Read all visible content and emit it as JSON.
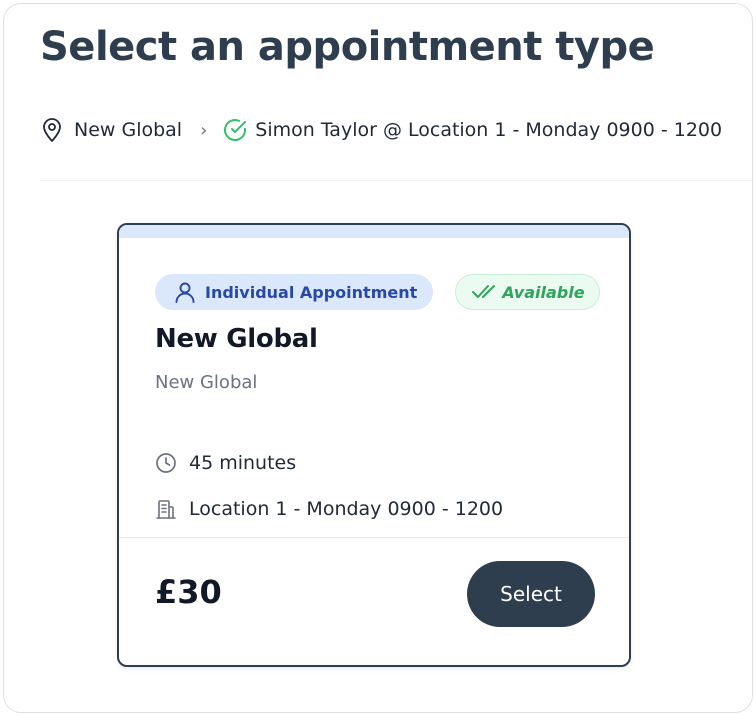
{
  "page": {
    "title": "Select an appointment type"
  },
  "breadcrumb": {
    "location_icon": "map-pin-icon",
    "location_label": "New Global",
    "separator_icon": "chevron-right-icon",
    "selected_icon": "check-circle-icon",
    "selected_label": "Simon Taylor @ Location 1 - Monday 0900 - 1200"
  },
  "colors": {
    "title": "#2f3e4f",
    "badge_blue_bg": "#dbe7fb",
    "badge_blue_text": "#2849a6",
    "available_green": "#2fa55b",
    "check_green": "#34c06a",
    "button_bg": "#2f3e4f"
  },
  "card": {
    "type_badge": {
      "icon": "user-icon",
      "label": "Individual Appointment"
    },
    "status_badge": {
      "icon": "double-check-icon",
      "label": "Available"
    },
    "name": "New Global",
    "subtitle": "New Global",
    "duration": {
      "icon": "clock-icon",
      "label": "45 minutes"
    },
    "location": {
      "icon": "building-icon",
      "label": "Location 1 - Monday 0900 - 1200"
    },
    "price": "£30",
    "select_label": "Select"
  }
}
